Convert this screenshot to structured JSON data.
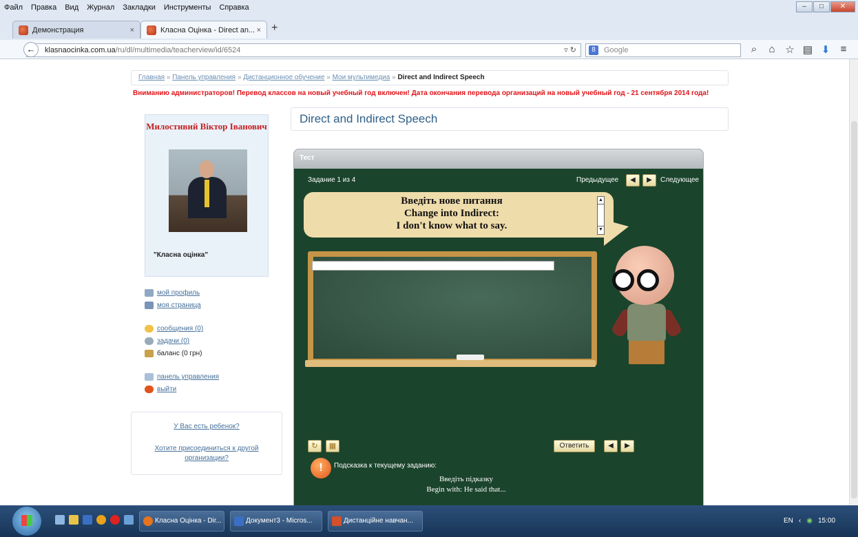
{
  "menubar": {
    "items": [
      "Файл",
      "Правка",
      "Вид",
      "Журнал",
      "Закладки",
      "Инструменты",
      "Справка"
    ]
  },
  "tabs": [
    {
      "label": "Демонстрация"
    },
    {
      "label": "Класна Оцінка - Direct an..."
    }
  ],
  "navbar": {
    "url_host": "klasnaocinka.com.ua",
    "url_path": "/ru/dl/multimedia/teacherview/id/6524",
    "search_placeholder": "Google"
  },
  "breadcrumb": {
    "items": [
      "Главная",
      "Панель управления",
      "Дистанционное обучение",
      "Мои мультимедиа"
    ],
    "separator": "»",
    "current": "Direct and Indirect Speech"
  },
  "alert": "Вниманию администраторов! Перевод классов на новый учебный год включен! Дата окончания перевода организаций на новый учебный год - 21 сентября 2014 года!",
  "profile": {
    "name": "Милостивий Віктор Іванович",
    "org": "\"Класна оцінка\""
  },
  "side_links": {
    "profile": "мой профиль",
    "page": "моя страница",
    "messages": "сообщения (0)",
    "tasks": "задачи (0)",
    "balance": "баланс (0 грн)",
    "control_panel": "панель управления",
    "logout": "выйти"
  },
  "child_box": {
    "child_link": "У Вас есть ребенок?",
    "join_link": "Хотите присоединиться к другой организации?"
  },
  "page_title": "Direct and Indirect Speech",
  "quiz": {
    "header": "Тест",
    "counter": "Задание 1 из 4",
    "prev_label": "Предыдущее",
    "next_label": "Следующее",
    "question_lines": [
      "Введіть нове питання",
      "Change into Indirect:",
      "I don't know what to say."
    ],
    "answer_value": "",
    "answer_button": "Ответить",
    "hint_label": "Подсказка к текущему заданию:",
    "hint_lines": [
      "Введіть підказку",
      "Begin with: He said that..."
    ]
  },
  "taskbar": {
    "tasks": [
      "Класна Оцінка - Dir...",
      "Документ3 - Micros...",
      "Дистанційне навчан..."
    ],
    "lang": "EN",
    "time": "15:00"
  },
  "colors": {
    "alert": "#e0141a",
    "profile_name": "#c52020",
    "link": "#46709a",
    "title": "#2e5f87",
    "quiz_bg": "#1b442c",
    "bubble": "#efdcab",
    "board_frame": "#c69548"
  }
}
